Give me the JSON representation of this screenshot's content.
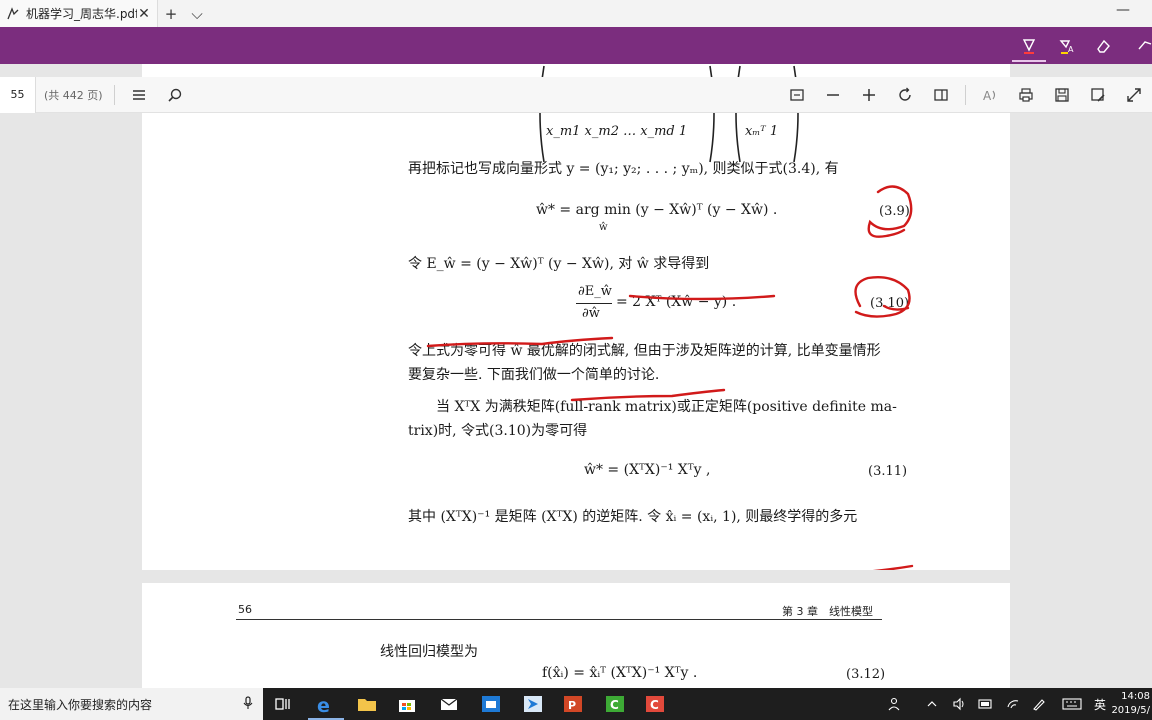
{
  "tab": {
    "title": "机器学习_周志华.pdf",
    "close": "✕",
    "new_tab": "+",
    "tab_list": "⌵"
  },
  "window": {
    "minimize": "—"
  },
  "pdf_toolbar": {
    "page_number": "55",
    "page_total": "(共 442 页)"
  },
  "page1": {
    "matrix_row_bottom": "x_m1 x_m2 … x_md 1",
    "text1": "再把标记也写成向量形式 y = (y₁; y₂; . . . ; yₘ), 则类似于式(3.4), 有",
    "eq39": "ŵ* = arg min (y − Xŵ)ᵀ (y − Xŵ) .",
    "eq39_sub": "ŵ",
    "eq39_no": "(3.9)",
    "text2": "令 E_ŵ = (y − Xŵ)ᵀ (y − Xŵ), 对 ŵ 求导得到",
    "eq310_num": "∂E_ŵ",
    "eq310_den": "∂ŵ",
    "eq310_rhs": "= 2 Xᵀ (Xŵ − y) .",
    "eq310_no": "(3.10)",
    "text3": "令上式为零可得 ŵ 最优解的闭式解, 但由于涉及矩阵逆的计算, 比单变量情形",
    "text4": "要复杂一些. 下面我们做一个简单的讨论.",
    "text5": "当 XᵀX 为满秩矩阵(full-rank matrix)或正定矩阵(positive definite ma-",
    "text6": "trix)时, 令式(3.10)为零可得",
    "eq311": "ŵ* = (XᵀX)⁻¹ Xᵀy ,",
    "eq311_no": "(3.11)",
    "text7": "其中 (XᵀX)⁻¹ 是矩阵 (XᵀX) 的逆矩阵. 令 x̂ᵢ = (xᵢ, 1), 则最终学得的多元"
  },
  "page2": {
    "page_no": "56",
    "chapter": "第 3 章　线性模型",
    "text1": "线性回归模型为",
    "eq312": "f(x̂ᵢ) = x̂ᵢᵀ (XᵀX)⁻¹ Xᵀy .",
    "eq312_no": "(3.12)"
  },
  "taskbar": {
    "search_placeholder": "在这里输入你要搜索的内容",
    "ime": "英",
    "time": "14:08",
    "date": "2019/5/"
  },
  "colors": {
    "ink_bar": "#7b2d7e",
    "annotation": "#d11a1a"
  }
}
